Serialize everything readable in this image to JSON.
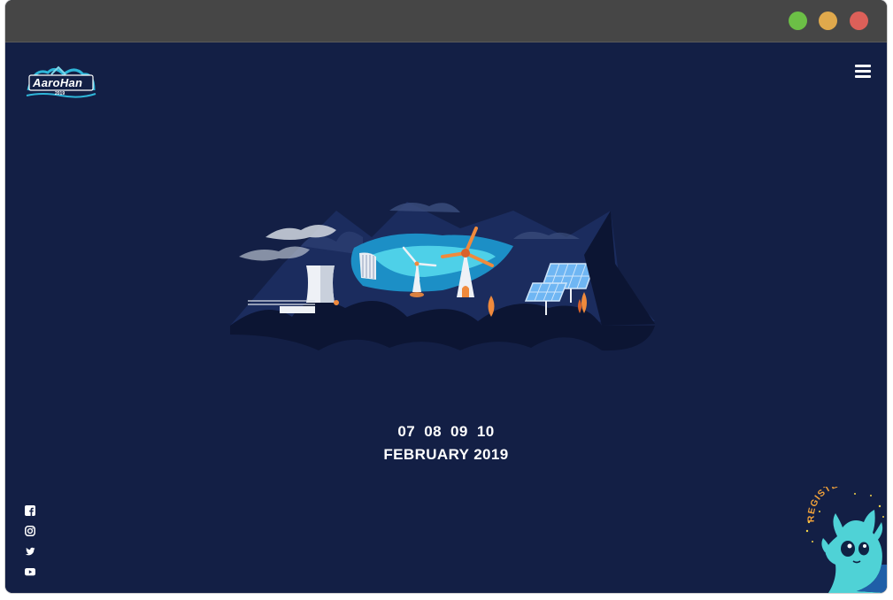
{
  "window": {
    "controls": [
      "minimize",
      "maximize",
      "close"
    ]
  },
  "brand": {
    "logo_text": "AaroHan",
    "logo_year": "2019"
  },
  "header": {
    "menu_icon": "hamburger-menu-icon"
  },
  "event": {
    "dates": "07  08  09  10",
    "month_year": "FEBRUARY 2019"
  },
  "social": [
    {
      "name": "facebook",
      "icon": "facebook-icon"
    },
    {
      "name": "instagram",
      "icon": "instagram-icon"
    },
    {
      "name": "twitter",
      "icon": "twitter-icon"
    },
    {
      "name": "youtube",
      "icon": "youtube-icon"
    }
  ],
  "register": {
    "label": "REGISTER"
  },
  "colors": {
    "background": "#131f45",
    "titlebar": "#464646",
    "accent_orange": "#f08a3c",
    "accent_cyan": "#2fb6d9"
  }
}
